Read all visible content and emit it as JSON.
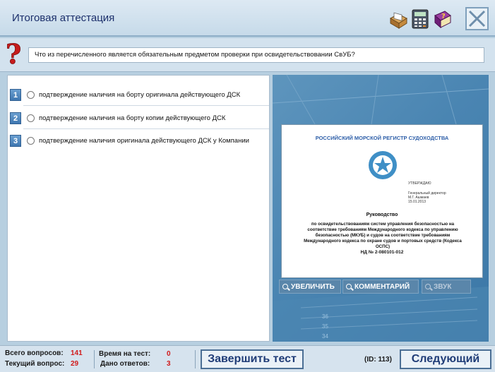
{
  "header": {
    "title": "Итоговая аттестация",
    "tools": [
      "card-index-icon",
      "calculator-icon",
      "help-book-icon"
    ],
    "close": "close-icon"
  },
  "question": {
    "text": "Что из перечисленного является обязательным предметом проверки при освидетельствовании СвУБ?"
  },
  "answers": [
    {
      "num": "1",
      "text": "подтверждение наличия на борту оригинала действующего ДСК"
    },
    {
      "num": "2",
      "text": "подтверждение наличия на борту копии действующего ДСК"
    },
    {
      "num": "3",
      "text": "подтверждение наличия оригинала действующего ДСК у Компании"
    }
  ],
  "document": {
    "org": "РОССИЙСКИЙ МОРСКОЙ РЕГИСТР СУДОХОДСТВА",
    "approve": "УТВЕРЖДАЮ",
    "director_lines": [
      "Генеральный директор",
      "М.Г. Ашмаев",
      "15.01.2013"
    ],
    "heading": "Руководство",
    "body": "по освидетельствованиям систем управления безопасностью на соответствие требованиям Международного кодекса по управлению безопасностью (МКУБ) и судов на соответствие требованиям Международного кодекса по охране судов и портовых средств (Кодекса ОСПС)",
    "code": "НД № 2-080101-012"
  },
  "image_buttons": {
    "zoom": "УВЕЛИЧИТЬ",
    "comment": "КОММЕНТАРИЙ",
    "sound": "ЗВУК"
  },
  "image_bg_numbers": [
    "36",
    "35",
    "34"
  ],
  "footer": {
    "total_label": "Всего вопросов:",
    "total_value": "141",
    "current_label": "Текущий вопрос:",
    "current_value": "29",
    "time_label": "Время на тест:",
    "time_value": "0",
    "answered_label": "Дано ответов:",
    "answered_value": "3",
    "finish_label": "Завершить тест",
    "id_text": "(ID: 113)",
    "next_label": "Следующий"
  },
  "colors": {
    "accent": "#1f3c77",
    "value_red": "#d11a1a",
    "image_panel": "#4a85b2"
  }
}
